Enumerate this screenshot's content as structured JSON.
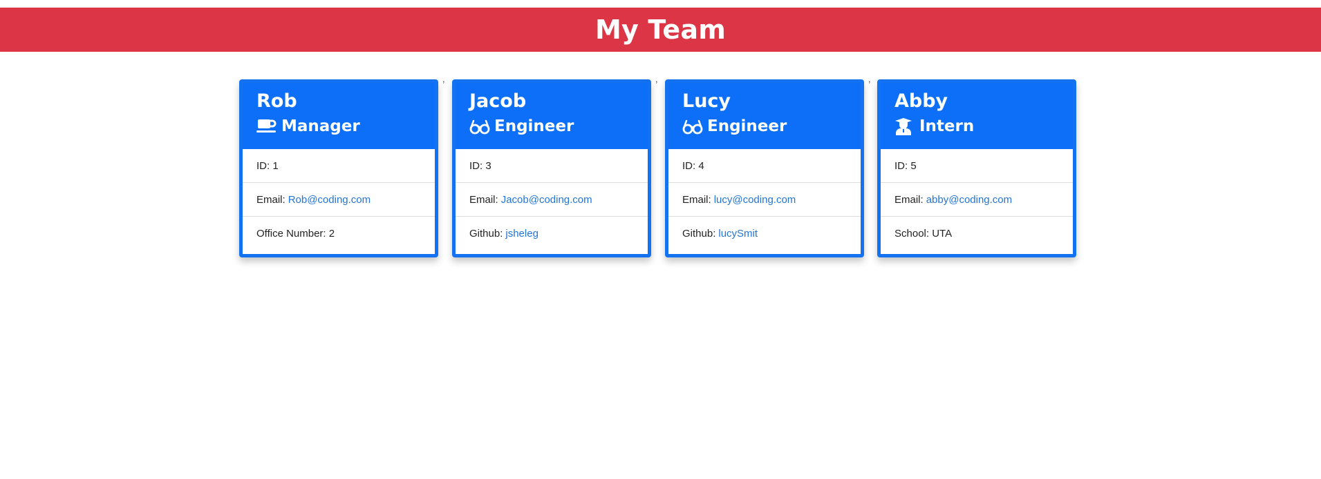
{
  "header": {
    "title": "My Team"
  },
  "separator": ",",
  "colors": {
    "header_bg": "#dc3545",
    "card_header_bg": "#0d6ff7",
    "card_border": "#1471f0",
    "link": "#2275d8"
  },
  "team": [
    {
      "name": "Rob",
      "role": "Manager",
      "icon": "coffee-mug-icon",
      "id_label": "ID:",
      "id": "1",
      "email_label": "Email:",
      "email": "Rob@coding.com",
      "extra_label": "Office Number:",
      "extra": "2",
      "extra_is_link": false
    },
    {
      "name": "Jacob",
      "role": "Engineer",
      "icon": "glasses-icon",
      "id_label": "ID:",
      "id": "3",
      "email_label": "Email:",
      "email": "Jacob@coding.com",
      "extra_label": "Github:",
      "extra": "jsheleg",
      "extra_is_link": true
    },
    {
      "name": "Lucy",
      "role": "Engineer",
      "icon": "glasses-icon",
      "id_label": "ID:",
      "id": "4",
      "email_label": "Email:",
      "email": "lucy@coding.com",
      "extra_label": "Github:",
      "extra": "lucySmit",
      "extra_is_link": true
    },
    {
      "name": "Abby",
      "role": "Intern",
      "icon": "graduate-icon",
      "id_label": "ID:",
      "id": "5",
      "email_label": "Email:",
      "email": "abby@coding.com",
      "extra_label": "School:",
      "extra": "UTA",
      "extra_is_link": false
    }
  ]
}
